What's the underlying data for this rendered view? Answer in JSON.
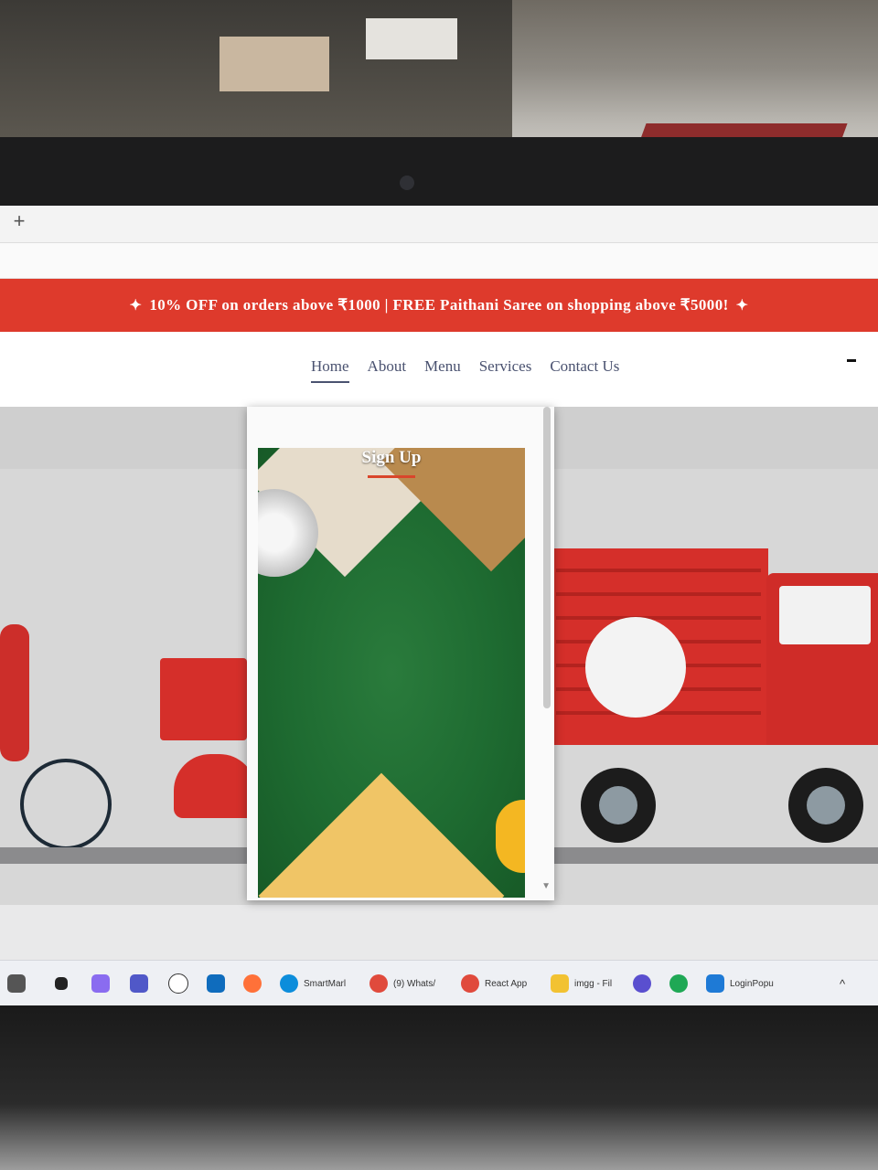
{
  "browser": {
    "new_tab_glyph": "+"
  },
  "promo": {
    "icon_left": "sparkle-icon",
    "text": "10% OFF on orders above ₹1000 | FREE Paithani Saree on shopping above ₹5000!",
    "icon_right": "sparkle-icon",
    "background": "#de3a2c"
  },
  "nav": {
    "items": [
      {
        "label": "Home",
        "active": true
      },
      {
        "label": "About"
      },
      {
        "label": "Menu"
      },
      {
        "label": "Services"
      },
      {
        "label": "Contact Us"
      }
    ]
  },
  "modal": {
    "title": "Sign Up",
    "accent": "#d9462b"
  },
  "taskbar": {
    "items": [
      {
        "label": "SmartMarl"
      },
      {
        "label": "(9) Whats/"
      },
      {
        "label": "React App"
      },
      {
        "label": "imgg - Fil"
      },
      {
        "label": "LoginPopu"
      }
    ],
    "tray": "^"
  }
}
